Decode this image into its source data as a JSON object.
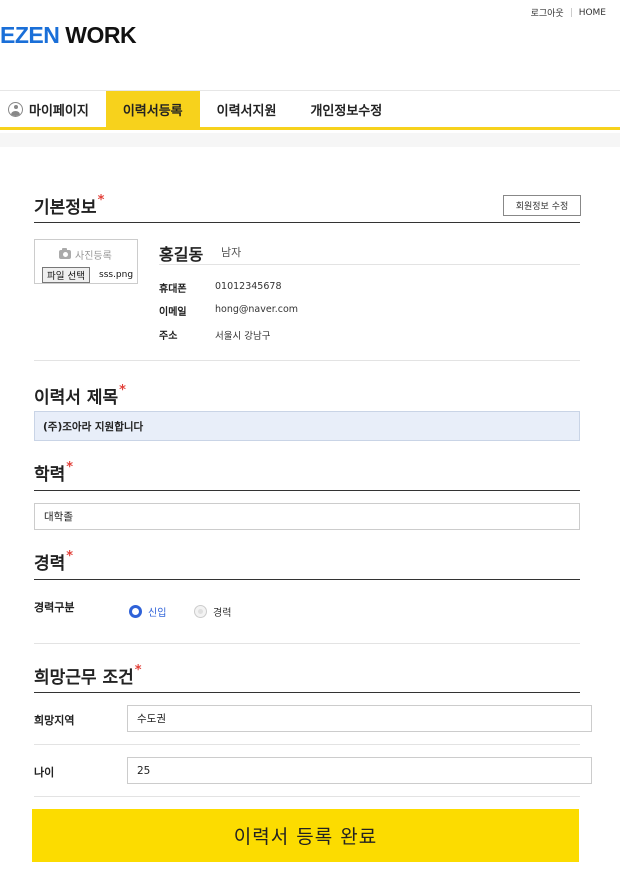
{
  "header": {
    "logout_label": "로그아웃",
    "home_label": "HOME",
    "logo_part1": "EZEN",
    "logo_part2": "WORK"
  },
  "nav": {
    "items": [
      {
        "label": "마이페이지",
        "icon": "user-circle-icon",
        "active": false
      },
      {
        "label": "이력서등록",
        "active": true
      },
      {
        "label": "이력서지원",
        "active": false
      },
      {
        "label": "개인정보수정",
        "active": false
      }
    ],
    "active_color": "#f7d21c"
  },
  "basic_info": {
    "title": "기본정보",
    "required_mark": "*",
    "edit_button": "회원정보 수정",
    "photo_label": "사진등록",
    "photo_icon": "camera-icon",
    "file_button": "파일 선택",
    "file_name": "sss.png",
    "name": "홍길동",
    "gender": "남자",
    "phone_label": "휴대폰",
    "phone_value": "01012345678",
    "email_label": "이메일",
    "email_value": "hong@naver.com",
    "address_label": "주소",
    "address_value": "서울시 강남구"
  },
  "resume_title": {
    "title": "이력서 제목",
    "required_mark": "*",
    "value": "(주)조아라 지원합니다"
  },
  "education": {
    "title": "학력",
    "required_mark": "*",
    "value": "대학졸"
  },
  "career": {
    "title": "경력",
    "required_mark": "*",
    "type_label": "경력구분",
    "options": [
      {
        "label": "신입",
        "selected": true
      },
      {
        "label": "경력",
        "selected": false
      }
    ]
  },
  "desired": {
    "title": "희망근무 조건",
    "required_mark": "*",
    "region_label": "희망지역",
    "region_value": "수도권",
    "age_label": "나이",
    "age_value": "25"
  },
  "submit": {
    "label": "이력서 등록 완료",
    "color": "#fcdc00"
  }
}
